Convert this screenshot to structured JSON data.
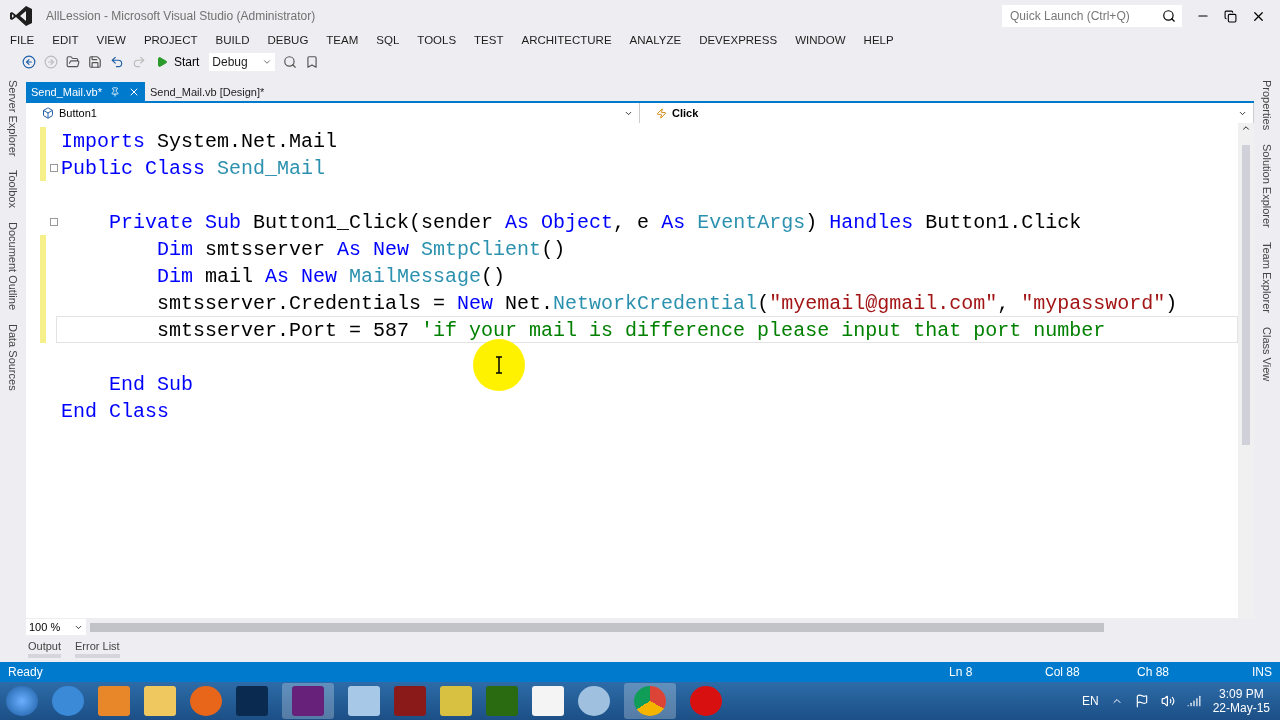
{
  "window": {
    "title": "AllLession - Microsoft Visual Studio (Administrator)",
    "quick_launch": {
      "placeholder": "Quick Launch (Ctrl+Q)"
    }
  },
  "menu": [
    "FILE",
    "EDIT",
    "VIEW",
    "PROJECT",
    "BUILD",
    "DEBUG",
    "TEAM",
    "SQL",
    "TOOLS",
    "TEST",
    "ARCHITECTURE",
    "ANALYZE",
    "DEVEXPRESS",
    "WINDOW",
    "HELP"
  ],
  "toolbar": {
    "start": "Start",
    "configuration": "Debug"
  },
  "left_panels": [
    "Server Explorer",
    "Toolbox",
    "Document Outline",
    "Data Sources"
  ],
  "right_panels": [
    "Properties",
    "Solution Explorer",
    "Team Explorer",
    "Class View"
  ],
  "tabs": [
    {
      "label": "Send_Mail.vb*",
      "selected": true
    },
    {
      "label": "Send_Mail.vb [Design]*",
      "selected": false
    }
  ],
  "navigation": {
    "object": "Button1",
    "event": "Click"
  },
  "code": [
    {
      "modified": true,
      "current": false,
      "collapsible": false,
      "tokens": [
        {
          "kind": "kw",
          "t": "Imports"
        },
        {
          "kind": "plain",
          "t": " System.Net.Mail"
        }
      ]
    },
    {
      "modified": true,
      "current": false,
      "collapsible": true,
      "tokens": [
        {
          "kind": "kw",
          "t": "Public"
        },
        {
          "kind": "kw",
          "t": " Class"
        },
        {
          "kind": "type",
          "t": " Send_Mail"
        }
      ],
      "children": [
        {
          "modified": false,
          "current": false,
          "collapsible": false
        },
        {
          "modified": false,
          "current": false,
          "collapsible": true,
          "tokens": [
            {
              "kind": "kw",
              "t": "Private"
            },
            {
              "kind": "kw",
              "t": " Sub"
            },
            {
              "kind": "plain",
              "t": " Button1_Click(sender"
            },
            {
              "kind": "kw",
              "t": " As"
            },
            {
              "kind": "kw",
              "t": " Object"
            },
            {
              "kind": "plain",
              "t": ", e"
            },
            {
              "kind": "kw",
              "t": " As"
            },
            {
              "kind": "type",
              "t": " EventArgs"
            },
            {
              "kind": "plain",
              "t": ")"
            },
            {
              "kind": "kw",
              "t": " Handles"
            },
            {
              "kind": "plain",
              "t": " Button1.Click"
            }
          ],
          "children": [
            {
              "modified": true,
              "current": false,
              "collapsible": false,
              "tokens": [
                {
                  "kind": "kw",
                  "t": "Dim"
                },
                {
                  "kind": "plain",
                  "t": " smtsserver"
                },
                {
                  "kind": "kw",
                  "t": " As"
                },
                {
                  "kind": "kw",
                  "t": " New"
                },
                {
                  "kind": "type",
                  "t": " SmtpClient"
                },
                {
                  "kind": "plain",
                  "t": "()"
                }
              ]
            },
            {
              "modified": true,
              "current": false,
              "collapsible": false,
              "tokens": [
                {
                  "kind": "kw",
                  "t": "Dim"
                },
                {
                  "kind": "plain",
                  "t": " mail"
                },
                {
                  "kind": "kw",
                  "t": " As"
                },
                {
                  "kind": "kw",
                  "t": " New"
                },
                {
                  "kind": "type",
                  "t": " MailMessage"
                },
                {
                  "kind": "plain",
                  "t": "()"
                }
              ]
            },
            {
              "modified": true,
              "current": false,
              "collapsible": false,
              "tokens": [
                {
                  "kind": "plain",
                  "t": "smtsserver.Credentials ="
                },
                {
                  "kind": "kw",
                  "t": " New"
                },
                {
                  "kind": "plain",
                  "t": " Net."
                },
                {
                  "kind": "type",
                  "t": "NetworkCredential"
                },
                {
                  "kind": "plain",
                  "t": "("
                },
                {
                  "kind": "str",
                  "t": "\"myemail@gmail.com\""
                },
                {
                  "kind": "plain",
                  "t": ","
                },
                {
                  "kind": "str",
                  "t": " \"mypassword\""
                },
                {
                  "kind": "plain",
                  "t": ")"
                }
              ]
            },
            {
              "modified": true,
              "current": true,
              "collapsible": false,
              "tokens": [
                {
                  "kind": "plain",
                  "t": "smtsserver.Port = 587"
                },
                {
                  "kind": "comment",
                  "t": " 'if your mail is difference please input that port number"
                }
              ]
            },
            {
              "modified": false,
              "current": false,
              "collapsible": false
            }
          ]
        },
        {
          "modified": false,
          "current": false,
          "collapsible": false,
          "tokens": [
            {
              "kind": "kw",
              "t": "End"
            },
            {
              "kind": "kw",
              "t": " Sub"
            }
          ]
        }
      ]
    },
    {
      "modified": false,
      "current": false,
      "collapsible": false,
      "tokens": [
        {
          "kind": "kw",
          "t": "End"
        },
        {
          "kind": "kw",
          "t": " Class"
        }
      ]
    }
  ],
  "zoom": "100 %",
  "bottom_tabs": [
    "Output",
    "Error List"
  ],
  "status_bar": {
    "message": "Ready",
    "line": "Ln 8",
    "column": "Col 88",
    "char": "Ch 88",
    "mode": "INS"
  },
  "taskbar": {
    "language": "EN",
    "time": "3:09 PM",
    "date": "22-May-15"
  }
}
